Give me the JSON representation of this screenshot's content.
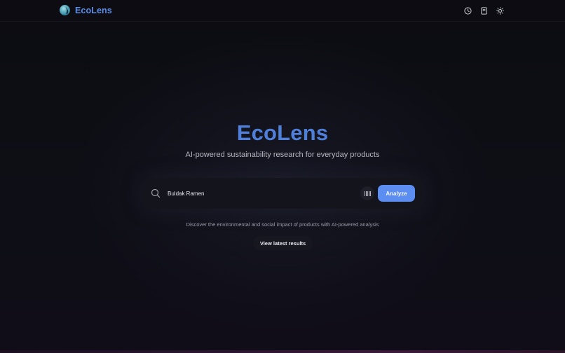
{
  "header": {
    "brand": "EcoLens",
    "actions": [
      {
        "icon": "clock-icon"
      },
      {
        "icon": "bookmark-icon"
      },
      {
        "icon": "sun-icon"
      }
    ]
  },
  "hero": {
    "title": "EcoLens",
    "subtitle": "AI-powered sustainability research for everyday products"
  },
  "search": {
    "value": "Buldak Ramen",
    "icon": "search-icon",
    "barcode_icon": "barcode-icon",
    "submit_label": "Analyze"
  },
  "footer_text": "Discover the environmental and social impact of products with AI-powered analysis",
  "latest_button_label": "View latest results",
  "colors": {
    "accent": "#5b8ef0",
    "brand_text": "#5a8de6",
    "background": "#0c0c12"
  }
}
